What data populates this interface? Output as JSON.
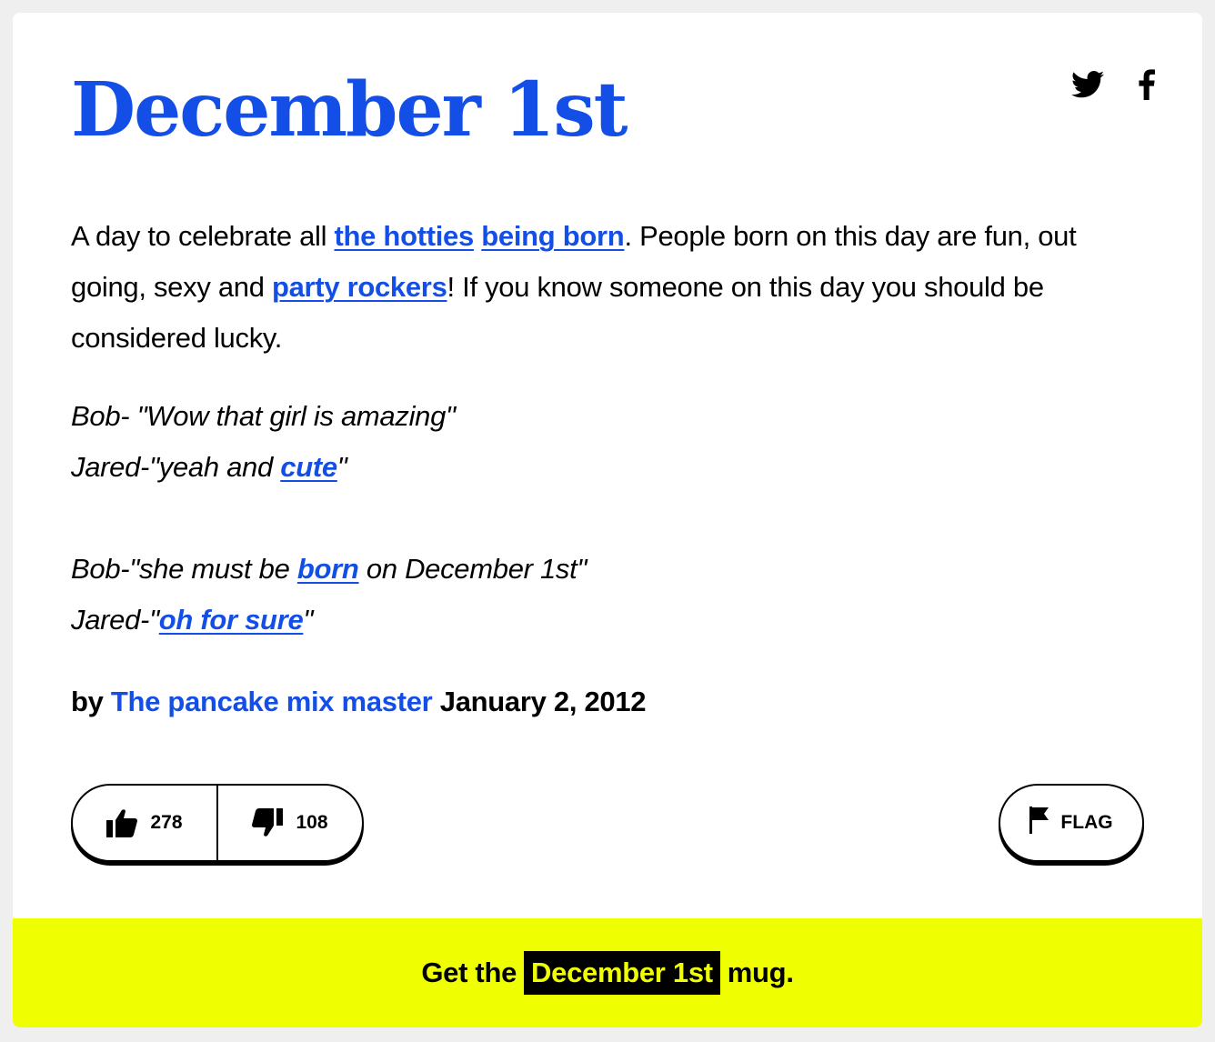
{
  "definition": {
    "word": "December 1st",
    "meaning_parts": [
      {
        "text": "A day to celebrate all "
      },
      {
        "link": "the hotties"
      },
      {
        "text": " "
      },
      {
        "link": "being born"
      },
      {
        "text": ". People born on this day are fun, out going, sexy and "
      },
      {
        "link": "party rockers"
      },
      {
        "text": "! If you know someone on this day you should be considered lucky."
      }
    ],
    "example_lines": [
      [
        {
          "text": "Bob- \"Wow that girl is amazing\""
        }
      ],
      [
        {
          "text": "Jared-\"yeah and "
        },
        {
          "link": "cute"
        },
        {
          "text": "\""
        }
      ],
      [],
      [
        {
          "text": "Bob-\"she must be "
        },
        {
          "link": "born"
        },
        {
          "text": " on December 1st\""
        }
      ],
      [
        {
          "text": "Jared-\""
        },
        {
          "link": "oh for sure"
        },
        {
          "text": "\""
        }
      ]
    ],
    "by_label": "by",
    "author": "The pancake mix master",
    "date": "January 2, 2012"
  },
  "share": {
    "icons": [
      "twitter-icon",
      "facebook-icon"
    ]
  },
  "votes": {
    "up_count": "278",
    "down_count": "108"
  },
  "flag": {
    "label": "FLAG"
  },
  "mug": {
    "prefix": "Get the",
    "word": "December 1st",
    "suffix": "mug."
  },
  "colors": {
    "link_blue": "#134fe6",
    "banner_yellow": "#effe00",
    "page_bg": "#efefef"
  }
}
